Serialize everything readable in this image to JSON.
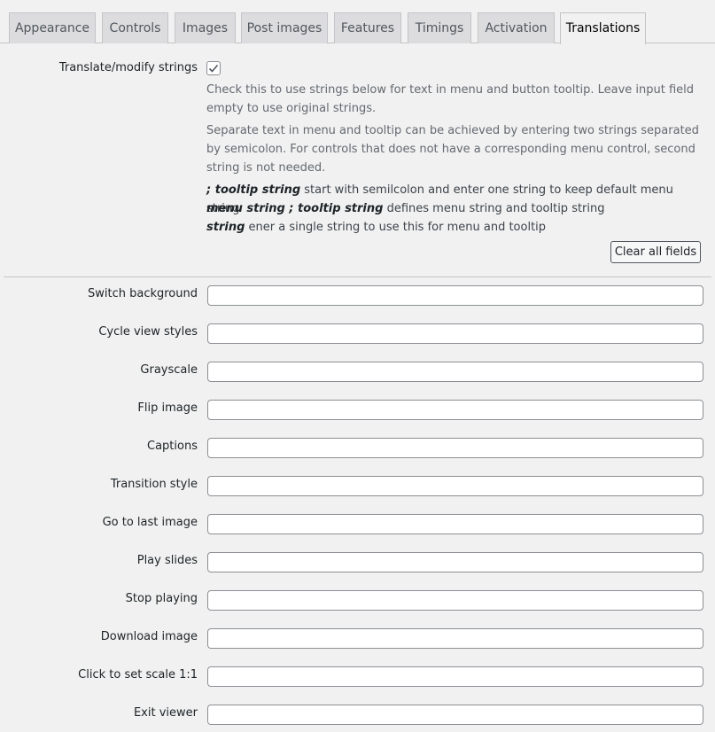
{
  "tabs": [
    {
      "label": "Appearance"
    },
    {
      "label": "Controls"
    },
    {
      "label": "Images"
    },
    {
      "label": "Post images"
    },
    {
      "label": "Features"
    },
    {
      "label": "Timings"
    },
    {
      "label": "Activation"
    },
    {
      "label": "Translations",
      "active": true
    }
  ],
  "translate": {
    "label": "Translate/modify strings",
    "checked": true,
    "desc1": "Check this to use strings below for text in menu and button tooltip. Leave input field empty to use original strings.",
    "desc2": "Separate text in menu and tooltip can be achieved by entering two strings separated by semicolon. For controls that does not have a corresponding menu control, second string is not needed.",
    "syntax": [
      {
        "key": "; tooltip string",
        "text": " start with semilcolon and enter one string to keep default menu string"
      },
      {
        "key": "menu string ; tooltip string",
        "text": " defines menu string and tooltip string"
      },
      {
        "key": "string",
        "text": " ener a single string to use this for menu and tooltip"
      }
    ],
    "clear_button": "Clear all fields"
  },
  "fields": [
    {
      "label": "Switch background",
      "value": ""
    },
    {
      "label": "Cycle view styles",
      "value": ""
    },
    {
      "label": "Grayscale",
      "value": ""
    },
    {
      "label": "Flip image",
      "value": ""
    },
    {
      "label": "Captions",
      "value": ""
    },
    {
      "label": "Transition style",
      "value": ""
    },
    {
      "label": "Go to last image",
      "value": ""
    },
    {
      "label": "Play slides",
      "value": ""
    },
    {
      "label": "Stop playing",
      "value": ""
    },
    {
      "label": "Download image",
      "value": ""
    },
    {
      "label": "Click to set scale 1:1",
      "value": ""
    },
    {
      "label": "Exit viewer",
      "value": ""
    }
  ],
  "icons": {
    "checkbox": "checkmark-icon"
  },
  "colors": {
    "background": "#f1f1f1",
    "tab_inactive": "#dcdcde",
    "border": "#c3c4c7"
  }
}
